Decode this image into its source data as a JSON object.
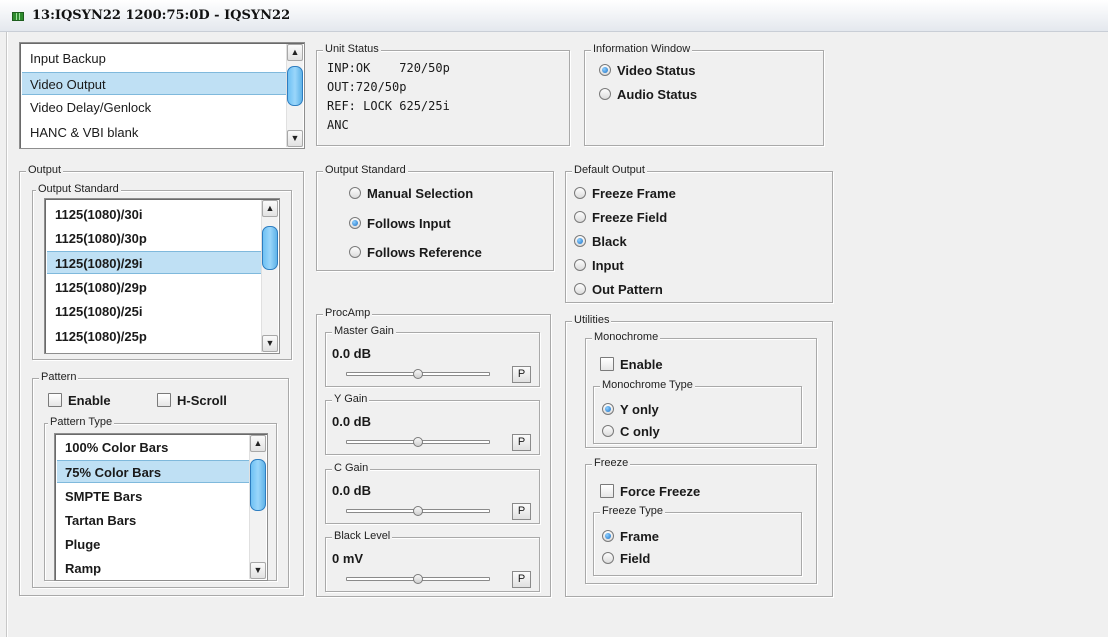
{
  "window": {
    "title": "13:IQSYN22 1200:75:0D - IQSYN22"
  },
  "menu_list": {
    "items": [
      {
        "label": "Input Backup",
        "selected": false
      },
      {
        "label": "Video Output",
        "selected": true
      },
      {
        "label": "Video Delay/Genlock",
        "selected": false
      },
      {
        "label": "HANC & VBI blank",
        "selected": false
      }
    ]
  },
  "unit_status": {
    "title": "Unit Status",
    "lines": [
      "INP:OK    720/50p",
      "OUT:720/50p",
      "REF: LOCK 625/25i",
      "ANC"
    ]
  },
  "info_window": {
    "title": "Information Window",
    "options": [
      {
        "label": "Video Status",
        "checked": true
      },
      {
        "label": "Audio Status",
        "checked": false
      }
    ]
  },
  "output": {
    "title": "Output",
    "output_standard": {
      "title": "Output Standard",
      "items": [
        {
          "label": "1125(1080)/30i",
          "selected": false
        },
        {
          "label": "1125(1080)/30p",
          "selected": false
        },
        {
          "label": "1125(1080)/29i",
          "selected": true
        },
        {
          "label": "1125(1080)/29p",
          "selected": false
        },
        {
          "label": "1125(1080)/25i",
          "selected": false
        },
        {
          "label": "1125(1080)/25p",
          "selected": false
        }
      ]
    },
    "pattern": {
      "title": "Pattern",
      "enable_label": "Enable",
      "enable_checked": false,
      "hscroll_label": "H-Scroll",
      "hscroll_checked": false,
      "pattern_type": {
        "title": "Pattern Type",
        "items": [
          {
            "label": "100% Color Bars",
            "selected": false
          },
          {
            "label": "75% Color Bars",
            "selected": true
          },
          {
            "label": "SMPTE Bars",
            "selected": false
          },
          {
            "label": "Tartan Bars",
            "selected": false
          },
          {
            "label": "Pluge",
            "selected": false
          },
          {
            "label": "Ramp",
            "selected": false
          }
        ]
      }
    }
  },
  "output_standard_mode": {
    "title": "Output Standard",
    "options": [
      {
        "label": "Manual Selection",
        "checked": false
      },
      {
        "label": "Follows Input",
        "checked": true
      },
      {
        "label": "Follows Reference",
        "checked": false
      }
    ]
  },
  "default_output": {
    "title": "Default Output",
    "options": [
      {
        "label": "Freeze Frame",
        "checked": false
      },
      {
        "label": "Freeze Field",
        "checked": false
      },
      {
        "label": "Black",
        "checked": true
      },
      {
        "label": "Input",
        "checked": false
      },
      {
        "label": "Out Pattern",
        "checked": false
      }
    ]
  },
  "procamp": {
    "title": "ProcAmp",
    "p_label": "P",
    "controls": [
      {
        "title": "Master Gain",
        "value": "0.0 dB",
        "level": 0.5
      },
      {
        "title": "Y Gain",
        "value": "0.0 dB",
        "level": 0.5
      },
      {
        "title": "C Gain",
        "value": "0.0 dB",
        "level": 0.5
      },
      {
        "title": "Black Level",
        "value": "0 mV",
        "level": 0.5
      }
    ]
  },
  "utilities": {
    "title": "Utilities",
    "monochrome": {
      "title": "Monochrome",
      "enable_label": "Enable",
      "enable_checked": false,
      "type_title": "Monochrome Type",
      "options": [
        {
          "label": "Y only",
          "checked": true
        },
        {
          "label": "C only",
          "checked": false
        }
      ]
    },
    "freeze": {
      "title": "Freeze",
      "force_label": "Force Freeze",
      "force_checked": false,
      "type_title": "Freeze Type",
      "options": [
        {
          "label": "Frame",
          "checked": true
        },
        {
          "label": "Field",
          "checked": false
        }
      ]
    }
  }
}
